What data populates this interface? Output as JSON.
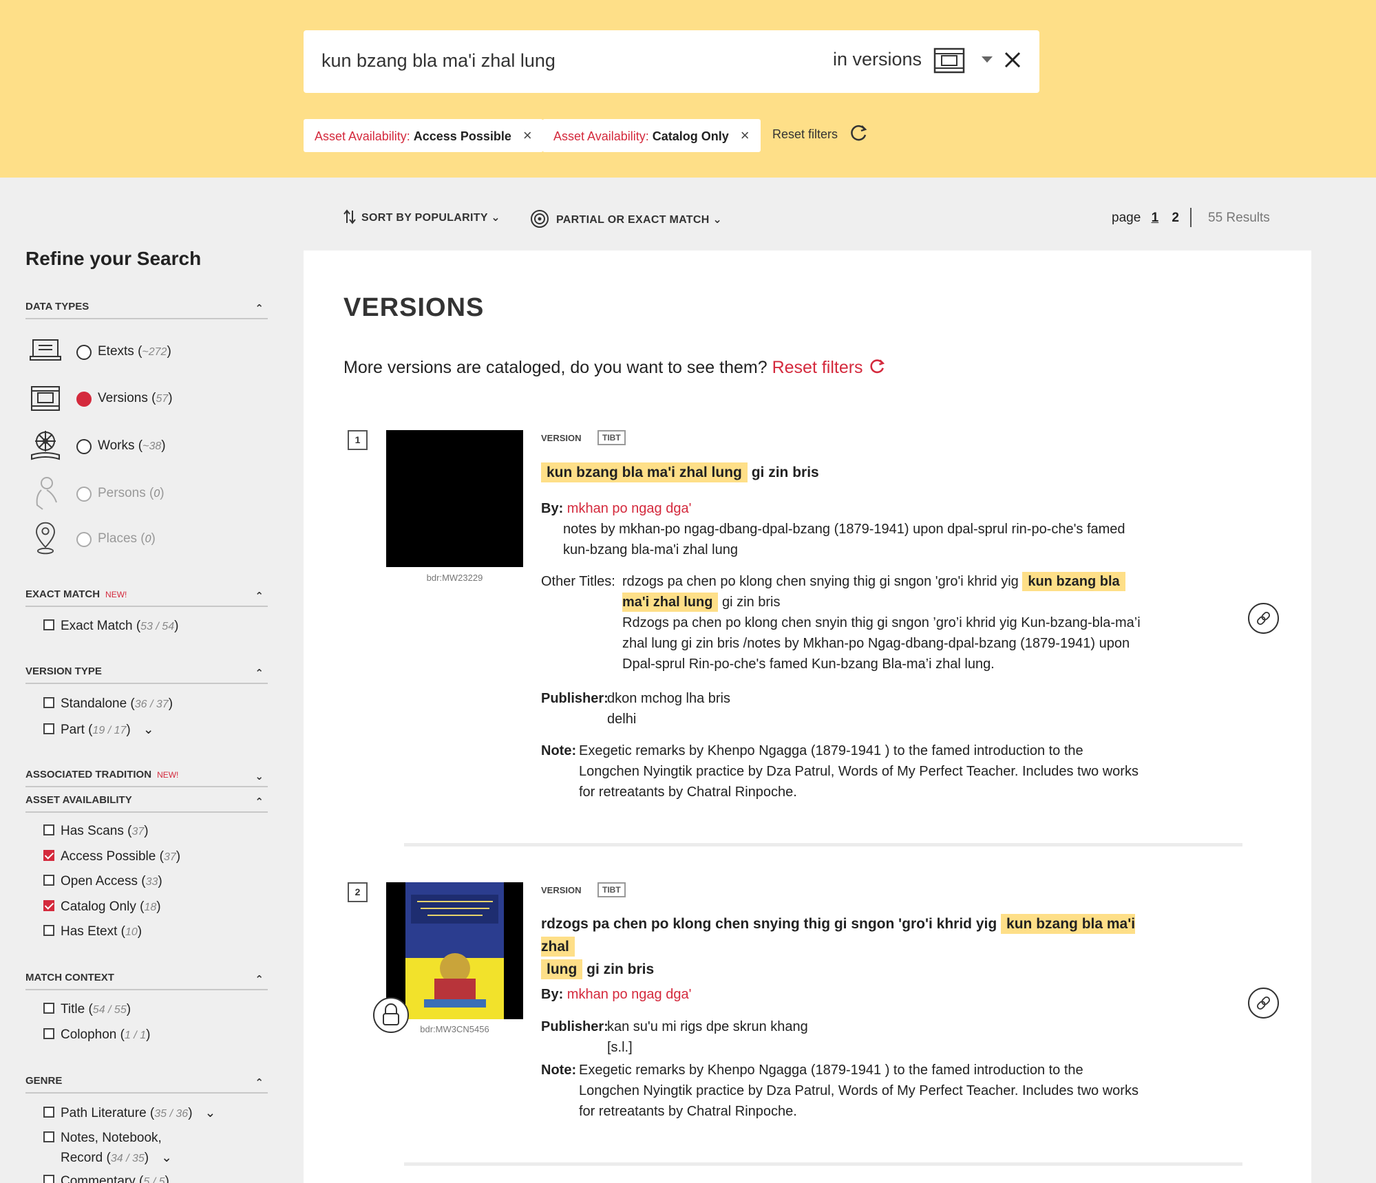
{
  "search": {
    "query": "kun bzang bla ma'i zhal lung",
    "scope": "in versions"
  },
  "filters": [
    {
      "key": "Asset Availability:",
      "value": "Access Possible"
    },
    {
      "key": "Asset Availability:",
      "value": "Catalog Only"
    }
  ],
  "reset_filters": "Reset filters",
  "sort": {
    "label": "SORT BY POPULARITY",
    "match": "PARTIAL OR EXACT MATCH"
  },
  "paging": {
    "label": "page",
    "p1": "1",
    "p2": "2",
    "results": "55 Results"
  },
  "sidebar": {
    "title": "Refine your Search",
    "data_types_header": "DATA TYPES",
    "data_types": [
      {
        "label": "Etexts (",
        "count": "~272",
        "close": ")"
      },
      {
        "label": "Versions (",
        "count": "57",
        "close": ")"
      },
      {
        "label": "Works (",
        "count": "~38",
        "close": ")"
      },
      {
        "label": "Persons (",
        "count": "0",
        "close": ")"
      },
      {
        "label": "Places (",
        "count": "0",
        "close": ")"
      }
    ],
    "exact_match_header": "EXACT MATCH",
    "new_label": "NEW!",
    "exact_match": {
      "label": "Exact Match (",
      "count": "53 / 54",
      "close": ")"
    },
    "version_type_header": "VERSION TYPE",
    "version_types": [
      {
        "label": "Standalone (",
        "count": "36 / 37",
        "close": ")"
      },
      {
        "label": "Part (",
        "count": "19 / 17",
        "close": ")"
      }
    ],
    "tradition_header": "ASSOCIATED TRADITION",
    "availability_header": "ASSET AVAILABILITY",
    "availability": [
      {
        "label": "Has Scans (",
        "count": "37",
        "close": ")"
      },
      {
        "label": "Access Possible (",
        "count": "37",
        "close": ")"
      },
      {
        "label": "Open Access (",
        "count": "33",
        "close": ")"
      },
      {
        "label": "Catalog Only (",
        "count": "18",
        "close": ")"
      },
      {
        "label": "Has Etext (",
        "count": "10",
        "close": ")"
      }
    ],
    "context_header": "MATCH CONTEXT",
    "context": [
      {
        "label": "Title (",
        "count": "54 / 55",
        "close": ")"
      },
      {
        "label": "Colophon (",
        "count": "1 / 1",
        "close": ")"
      }
    ],
    "genre_header": "GENRE",
    "genre": [
      {
        "label": "Path Literature (",
        "count": "35 / 36",
        "close": ")"
      },
      {
        "label": "Notes, Notebook,",
        "label2": "Record (",
        "count": "34 / 35",
        "close": ")"
      },
      {
        "label": "Commentary (",
        "count": "5 / 5",
        "close": ")"
      }
    ]
  },
  "main": {
    "heading": "VERSIONS",
    "more_text": "More versions are cataloged, do you want to see them?",
    "more_link": "Reset filters",
    "results": [
      {
        "num": "1",
        "id": "bdr:MW23229",
        "tag": "VERSION",
        "lang": "TIBT",
        "title_hl": "kun bzang bla ma'i zhal lung",
        "title_rest": "gi zin bris",
        "by_label": "By:",
        "by": "mkhan po ngag dga'",
        "by_note1": "notes by mkhan-po ngag-dbang-dpal-bzang (1879-1941) upon dpal-sprul rin-po-che's famed",
        "by_note2": "kun-bzang bla-ma'i zhal lung",
        "other_label": "Other Titles:",
        "other1_pre": "rdzogs pa chen po klong chen snying thig gi sngon 'gro'i khrid yig",
        "other1_hl_a": "kun bzang bla",
        "other1_hl_b": "ma'i zhal lung",
        "other1_post": "gi zin bris",
        "other2_l1": "Rdzogs pa chen po klong chen snyin thig gi sngon ’gro’i khrid yig Kun-bzang-bla-ma’i",
        "other2_l2": "zhal lung gi zin bris /notes by Mkhan-po Ngag-dbang-dpal-bzang (1879-1941) upon",
        "other2_l3": "Dpal-sprul Rin-po-che's famed Kun-bzang Bla-ma’i zhal lung.",
        "pub_label": "Publisher:",
        "pub1": "dkon mchog lha bris",
        "pub2": "delhi",
        "note_label": "Note:",
        "note1": "Exegetic remarks by Khenpo Ngagga (1879-1941 ) to the famed introduction to the",
        "note2": "Longchen Nyingtik practice by Dza Patrul, Words of My Perfect Teacher. Includes two works",
        "note3": "for retreatants by Chatral Rinpoche."
      },
      {
        "num": "2",
        "id": "bdr:MW3CN5456",
        "tag": "VERSION",
        "lang": "TIBT",
        "title_pre": "rdzogs pa chen po klong chen snying thig gi sngon 'gro'i khrid yig",
        "title_hl_a": "kun bzang bla ma'i zhal",
        "title_hl_b": "lung",
        "title_rest": "gi zin bris",
        "by_label": "By:",
        "by": "mkhan po ngag dga'",
        "pub_label": "Publisher:",
        "pub1": "kan su'u mi rigs dpe skrun khang",
        "pub2": "[s.l.]",
        "note_label": "Note:",
        "note1": "Exegetic remarks by Khenpo Ngagga (1879-1941 ) to the famed introduction to the",
        "note2": "Longchen Nyingtik practice by Dza Patrul, Words of My Perfect Teacher. Includes two works",
        "note3": "for retreatants by Chatral Rinpoche."
      }
    ]
  },
  "colors": {
    "accent": "#d42a3d",
    "band": "#fedf88",
    "highlight": "#fedf88"
  }
}
